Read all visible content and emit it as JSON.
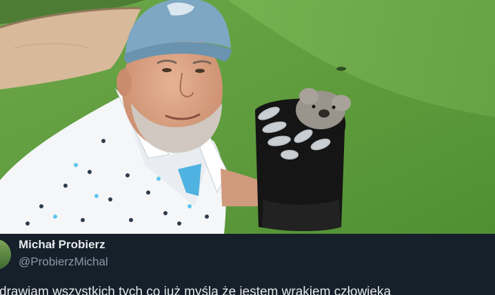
{
  "post": {
    "author_name": "Michał Probierz",
    "author_handle": "@ProbierzMichal",
    "text": "drawiam wszystkich tych co już myślą że jestem wrakiem człowieka"
  },
  "colors": {
    "background": "#15202b",
    "name_text": "#e7e9ea",
    "handle_text": "#8b98a5"
  },
  "icons": {
    "avatar": "avatar"
  }
}
